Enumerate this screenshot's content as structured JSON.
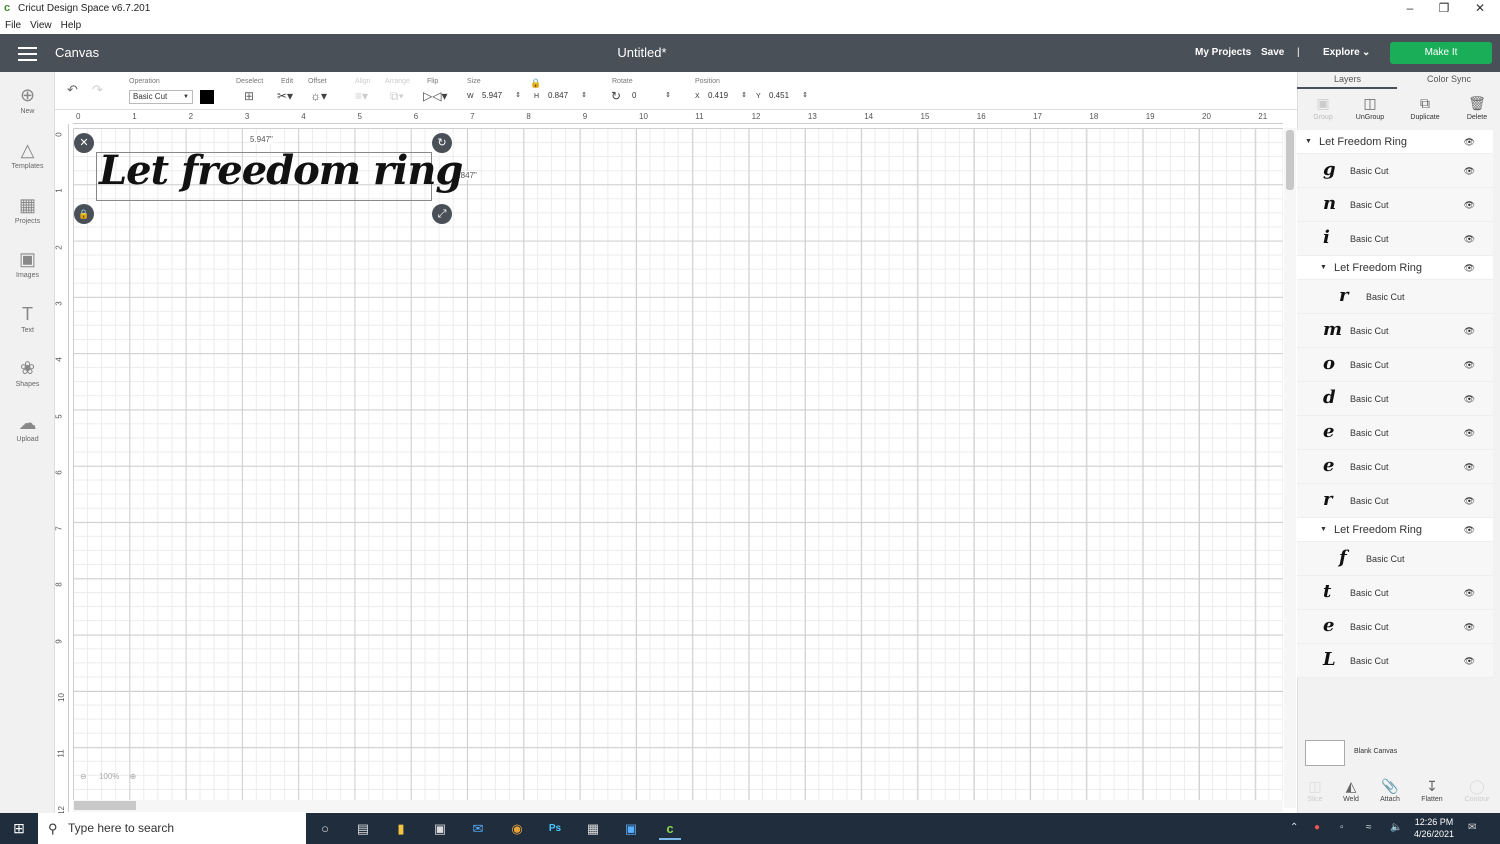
{
  "window": {
    "title": "Cricut Design Space  v6.7.201",
    "min_icon": "minimize-icon",
    "max_icon": "restore-icon",
    "close_icon": "close-icon"
  },
  "menu": [
    "File",
    "View",
    "Help"
  ],
  "header": {
    "section": "Canvas",
    "project_title": "Untitled*",
    "my_projects": "My Projects",
    "save": "Save",
    "separator": "|",
    "explore": "Explore",
    "make_it": "Make It"
  },
  "toolbar": {
    "operation_label": "Operation",
    "operation_value": "Basic Cut",
    "color": "#000000",
    "deselect_label": "Deselect",
    "edit_label": "Edit",
    "offset_label": "Offset",
    "align_label": "Align",
    "arrange_label": "Arrange",
    "flip_label": "Flip",
    "size_label": "Size",
    "w_label": "W",
    "w_value": "5.947",
    "h_label": "H",
    "h_value": "0.847",
    "rotate_label": "Rotate",
    "rotate_value": "0",
    "position_label": "Position",
    "x_label": "X",
    "x_value": "0.419",
    "y_label": "Y",
    "y_value": "0.451"
  },
  "sidebar": [
    {
      "label": "New",
      "icon": "plus-circle-icon"
    },
    {
      "label": "Templates",
      "icon": "shirt-icon"
    },
    {
      "label": "Projects",
      "icon": "projects-icon"
    },
    {
      "label": "Images",
      "icon": "image-icon"
    },
    {
      "label": "Text",
      "icon": "text-icon"
    },
    {
      "label": "Shapes",
      "icon": "shapes-icon"
    },
    {
      "label": "Upload",
      "icon": "upload-cloud-icon"
    }
  ],
  "ruler": {
    "h": [
      "0",
      "1",
      "2",
      "3",
      "4",
      "5",
      "6",
      "7",
      "8",
      "9",
      "10",
      "11",
      "12",
      "13",
      "14",
      "15",
      "16",
      "17",
      "18",
      "19",
      "20",
      "21"
    ],
    "v": [
      "0",
      "1",
      "2",
      "3",
      "4",
      "5",
      "6",
      "7",
      "8",
      "9",
      "10",
      "11",
      "12"
    ]
  },
  "canvas": {
    "text": "Let freedom ring",
    "width_label": "5.947\"",
    "height_label": "0.847\"",
    "zoom": "100%"
  },
  "panel": {
    "tabs": [
      "Layers",
      "Color Sync"
    ],
    "actions": [
      {
        "label": "Group",
        "enabled": false
      },
      {
        "label": "UnGroup",
        "enabled": true
      },
      {
        "label": "Duplicate",
        "enabled": true
      },
      {
        "label": "Delete",
        "enabled": true
      }
    ],
    "layers": [
      {
        "type": "group",
        "label": "Let Freedom Ring",
        "indent": 0
      },
      {
        "type": "layer",
        "glyph": "g",
        "label": "Basic Cut"
      },
      {
        "type": "layer",
        "glyph": "n",
        "label": "Basic Cut"
      },
      {
        "type": "layer",
        "glyph": "i",
        "label": "Basic Cut"
      },
      {
        "type": "group",
        "label": "Let Freedom Ring",
        "indent": 1
      },
      {
        "type": "sublayer",
        "glyph": "r",
        "label": "Basic Cut"
      },
      {
        "type": "layer",
        "glyph": "m",
        "label": "Basic Cut"
      },
      {
        "type": "layer",
        "glyph": "o",
        "label": "Basic Cut"
      },
      {
        "type": "layer",
        "glyph": "d",
        "label": "Basic Cut"
      },
      {
        "type": "layer",
        "glyph": "e",
        "label": "Basic Cut"
      },
      {
        "type": "layer",
        "glyph": "e",
        "label": "Basic Cut"
      },
      {
        "type": "layer",
        "glyph": "r",
        "label": "Basic Cut"
      },
      {
        "type": "group",
        "label": "Let Freedom Ring",
        "indent": 1
      },
      {
        "type": "sublayer",
        "glyph": "f",
        "label": "Basic Cut"
      },
      {
        "type": "layer",
        "glyph": "t",
        "label": "Basic Cut"
      },
      {
        "type": "layer",
        "glyph": "e",
        "label": "Basic Cut"
      },
      {
        "type": "layer",
        "glyph": "L",
        "label": "Basic Cut"
      }
    ],
    "blank_canvas": "Blank Canvas",
    "bottom_actions": [
      {
        "label": "Slice",
        "enabled": false
      },
      {
        "label": "Weld",
        "enabled": true
      },
      {
        "label": "Attach",
        "enabled": true
      },
      {
        "label": "Flatten",
        "enabled": true
      },
      {
        "label": "Contour",
        "enabled": false
      }
    ]
  },
  "taskbar": {
    "search_placeholder": "Type here to search",
    "time": "12:26 PM",
    "date": "4/26/2021"
  },
  "colors": {
    "header": "#4a5057",
    "make_it": "#1aae59",
    "taskbar": "#1f2d3d"
  }
}
